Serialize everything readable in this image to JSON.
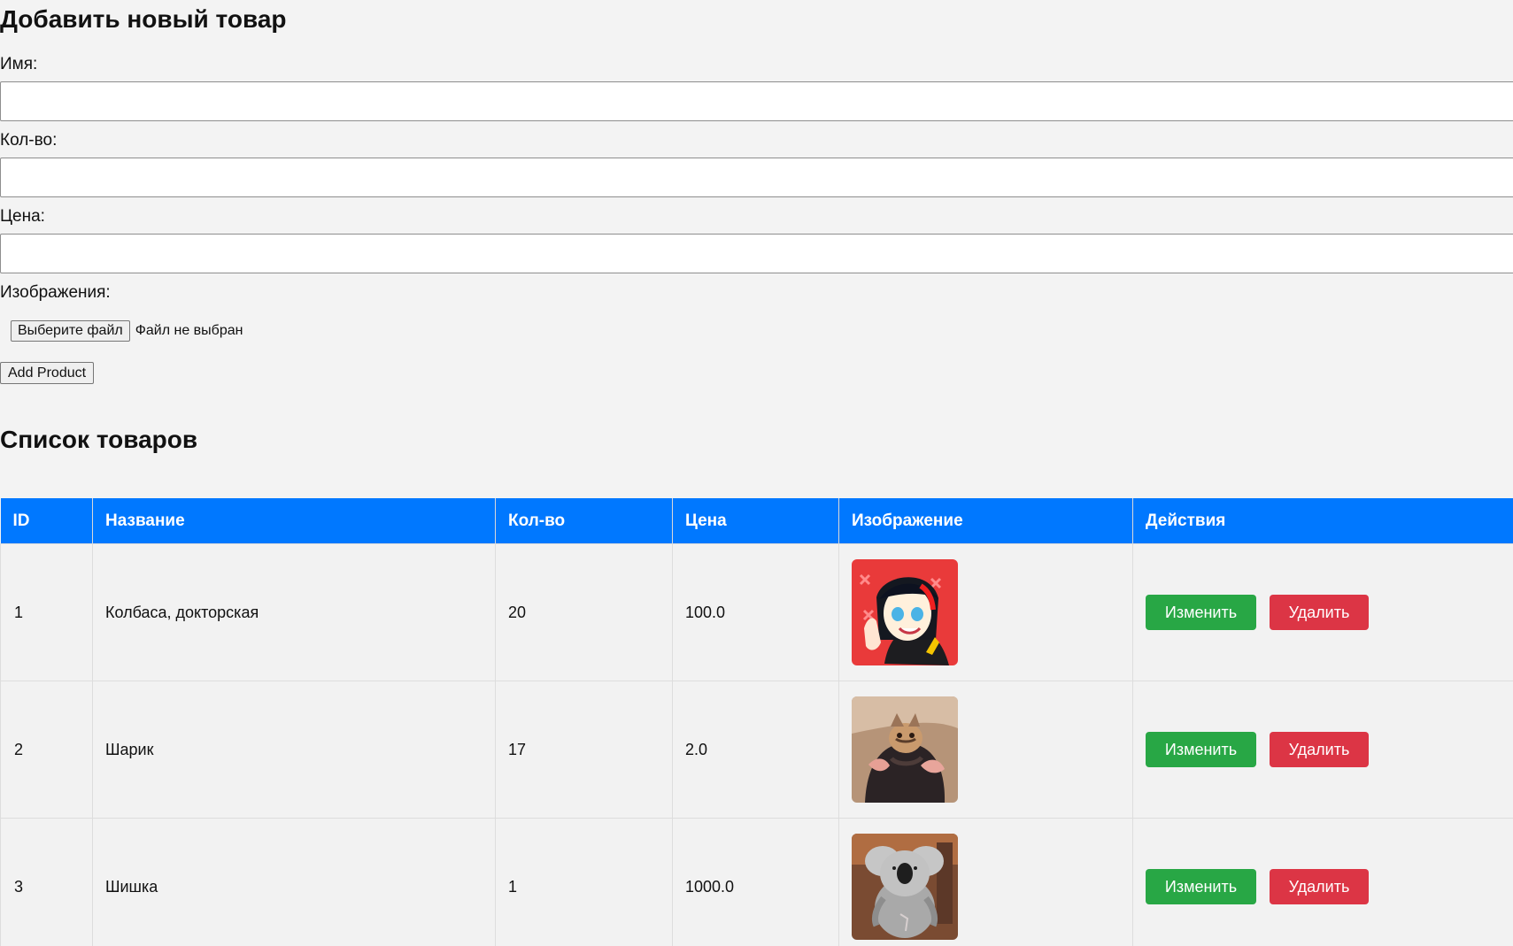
{
  "form": {
    "title": "Добавить новый товар",
    "name_label": "Имя:",
    "quantity_label": "Кол-во:",
    "price_label": "Цена:",
    "images_label": "Изображения:",
    "name_value": "",
    "quantity_value": "",
    "price_value": "",
    "file_button_label": "Выберите файл",
    "file_status": "Файл не выбран",
    "submit_label": "Add Product"
  },
  "product_list": {
    "title": "Список товаров",
    "headers": {
      "id": "ID",
      "name": "Название",
      "quantity": "Кол-во",
      "price": "Цена",
      "image": "Изображение",
      "actions": "Действия"
    },
    "rows": [
      {
        "id": "1",
        "name": "Колбаса, докторская",
        "quantity": "20",
        "price": "100.0",
        "image_icon": "anime-character-photo",
        "edit_label": "Изменить",
        "delete_label": "Удалить"
      },
      {
        "id": "2",
        "name": "Шарик",
        "quantity": "17",
        "price": "2.0",
        "image_icon": "kitten-photo",
        "edit_label": "Изменить",
        "delete_label": "Удалить"
      },
      {
        "id": "3",
        "name": "Шишка",
        "quantity": "1",
        "price": "1000.0",
        "image_icon": "koala-plush-photo",
        "edit_label": "Изменить",
        "delete_label": "Удалить"
      }
    ]
  },
  "colors": {
    "background": "#f3f3f3",
    "table_header": "#0078ff",
    "edit_button": "#28a745",
    "delete_button": "#dc3545"
  }
}
